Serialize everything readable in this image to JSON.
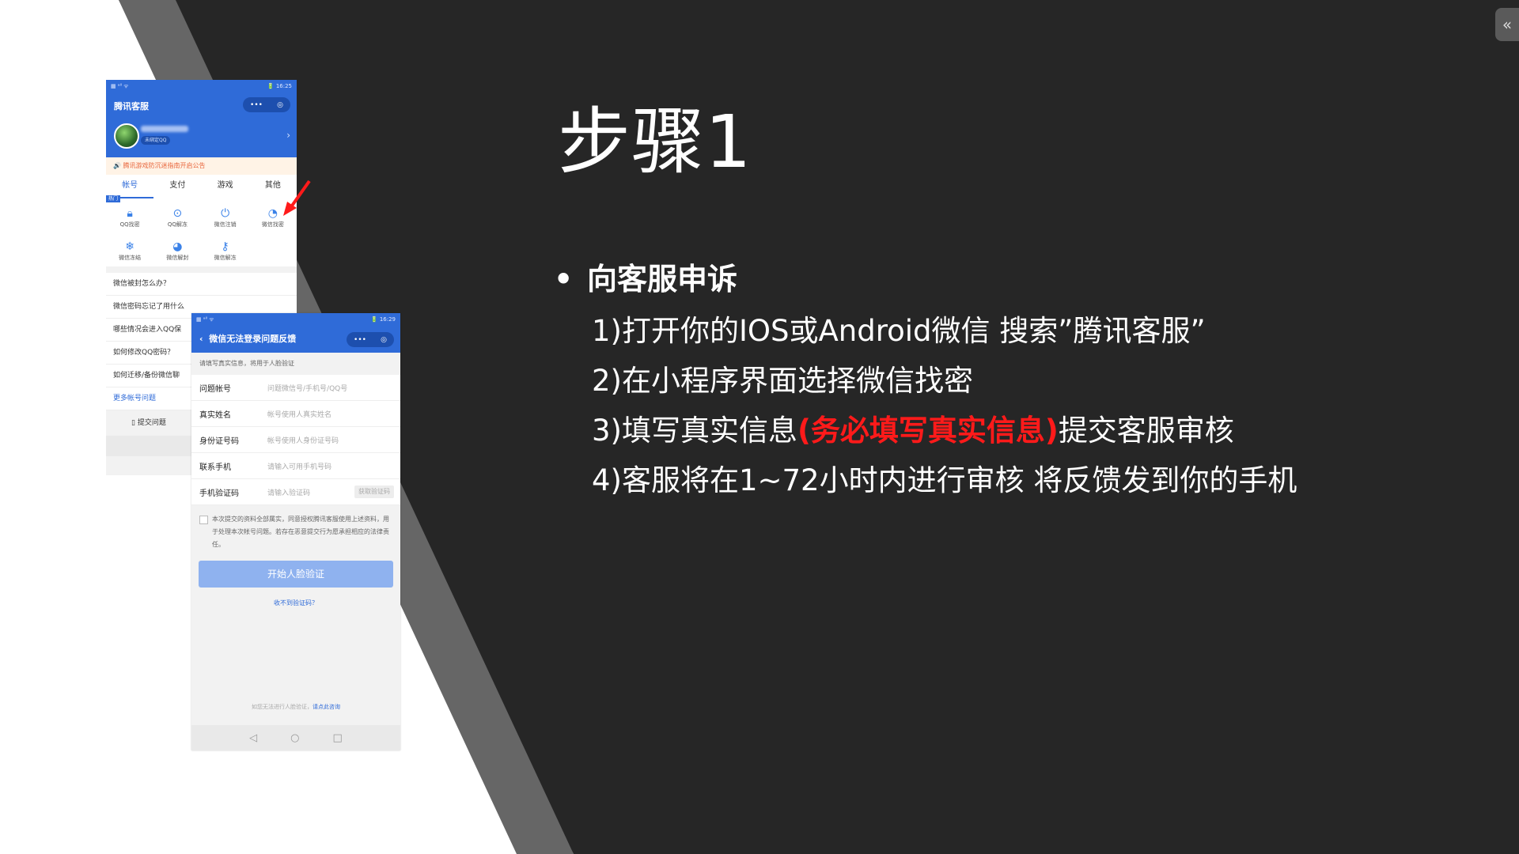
{
  "slide": {
    "title": "步骤1",
    "bullet": "向客服申诉",
    "steps": [
      {
        "text": "1)打开你的IOS或Android微信 搜索”腾讯客服”"
      },
      {
        "text": "2)在小程序界面选择微信找密"
      },
      {
        "prefix": "3)填写真实信息",
        "highlight": "(务必填写真实信息)",
        "suffix": "提交客服审核"
      },
      {
        "text": "4)客服将在1~72小时内进行审核 将反馈发到你的手机"
      }
    ],
    "collapse_icon": "«",
    "colors": {
      "background": "#262626",
      "accent_red": "#ff1a1a",
      "stripe": "#666666",
      "white_panel": "#ffffff"
    }
  },
  "phone1": {
    "status_left": "▦ ᵃˡˡ ᯤ",
    "status_right": "🔋 16:25",
    "app_title": "腾讯客服",
    "capsule_more": "•••",
    "capsule_close": "◎",
    "user_chip": "未绑定QQ",
    "notice": "🔊 腾讯游戏防沉迷指南开启公告",
    "tabs": [
      "帐号",
      "支付",
      "游戏",
      "其他"
    ],
    "hot_tag": "热门",
    "grid": [
      {
        "label": "QQ找密",
        "icon": "lock-icon"
      },
      {
        "label": "QQ解冻",
        "icon": "unlock-icon"
      },
      {
        "label": "微信注销",
        "icon": "power-icon"
      },
      {
        "label": "微信找密",
        "icon": "wechat-lock-icon"
      },
      {
        "label": "微信冻结",
        "icon": "snowflake-icon"
      },
      {
        "label": "微信解封",
        "icon": "wechat-unblock-icon"
      },
      {
        "label": "微信解冻",
        "icon": "key-icon"
      }
    ],
    "faq": [
      "微信被封怎么办？",
      "微信密码忘记了用什么",
      "哪些情况会进入QQ保",
      "如何修改QQ密码？",
      "如何迁移/备份微信聊",
      "更多帐号问题"
    ],
    "submit": "提交问题",
    "nav_back": "◁"
  },
  "phone2": {
    "status_left": "▦ ᵃˡˡ ᯤ",
    "status_right": "🔋 16:29",
    "title": "微信无法登录问题反馈",
    "back_icon": "‹",
    "capsule_more": "•••",
    "capsule_close": "◎",
    "hint": "请填写真实信息，将用于人脸验证",
    "fields": [
      {
        "label": "问题帐号",
        "placeholder": "问题微信号/手机号/QQ号"
      },
      {
        "label": "真实姓名",
        "placeholder": "帐号使用人真实姓名"
      },
      {
        "label": "身份证号码",
        "placeholder": "帐号使用人身份证号码"
      },
      {
        "label": "联系手机",
        "placeholder": "请输入可用手机号码"
      },
      {
        "label": "手机验证码",
        "placeholder": "请输入验证码"
      }
    ],
    "get_code": "获取验证码",
    "agreement": "本次提交的资料全部属实，同意授权腾讯客服使用上述资料，用于处理本次帐号问题。若存在恶意提交行为愿承担相应的法律责任。",
    "face_button": "开始人脸验证",
    "no_code": "收不到验证码？",
    "footnote_prefix": "如您无法进行人脸验证，",
    "footnote_link": "请点此咨询",
    "nav": [
      "◁",
      "○",
      "□"
    ]
  }
}
